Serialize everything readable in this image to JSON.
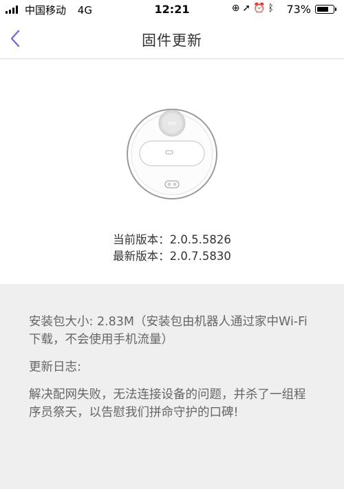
{
  "status_bar": {
    "carrier": "中国移动",
    "network": "4G",
    "time": "12:21",
    "battery_percent": "73%",
    "battery_level": 0.73
  },
  "nav": {
    "title": "固件更新",
    "back_icon": "chevron-left-icon",
    "accent_color": "#7b68c8"
  },
  "firmware": {
    "current_label": "当前版本：",
    "current_value": "2.0.5.5826",
    "latest_label": "最新版本：",
    "latest_value": "2.0.7.5830"
  },
  "info": {
    "package_text": "安装包大小: 2.83M（安装包由机器人通过家中Wi-Fi下载，不会使用手机流量）",
    "log_title": "更新日志:",
    "log_text": "解决配网失败，无法连接设备的问题，并杀了一组程序员祭天，以告慰我们拼命守护的口碑!"
  }
}
